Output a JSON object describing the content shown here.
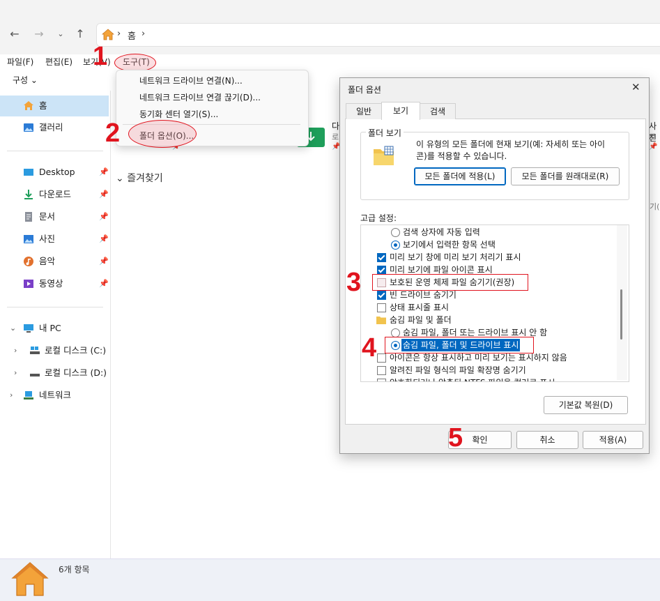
{
  "address": {
    "crumb": "홈"
  },
  "menubar": [
    {
      "label": "파일(F)"
    },
    {
      "label": "편집(E)"
    },
    {
      "label": "보기(V)"
    },
    {
      "label": "도구(T)"
    }
  ],
  "organize": "구성",
  "sidebar": {
    "home": "홈",
    "gallery": "갤러리",
    "pinned": [
      "Desktop",
      "다운로드",
      "문서",
      "사진",
      "음악",
      "동영상"
    ],
    "this_pc": "내 PC",
    "drive_c": "로컬 디스크 (C:)",
    "drive_d": "로컬 디스크 (D:)",
    "network": "네트워크"
  },
  "content": {
    "favorites": "즐겨찾기",
    "right_cut_1": "다",
    "right_cut_2": "로",
    "right_edge_1": "사진",
    "right_edge_2": "로",
    "right_edge_3": "기(",
    "pin_glyph": "📌"
  },
  "dropdown": [
    {
      "label": "네트워크 드라이브 연결(N)..."
    },
    {
      "label": "네트워크 드라이브 연결 끊기(D)..."
    },
    {
      "label": "동기화 센터 열기(S)..."
    },
    {
      "label": "폴더 옵션(O)..."
    }
  ],
  "dialog": {
    "title": "폴더 옵션",
    "close": "✕",
    "tabs": [
      "일반",
      "보기",
      "검색"
    ],
    "group_title": "폴더 보기",
    "group_desc_1": "이 유형의 모든 폴더에 현재 보기(예: 자세히 또는 아이",
    "group_desc_2": "콘)를 적용할 수 있습니다.",
    "apply_all": "모든 폴더에 적용(L)",
    "reset_all": "모든 폴더를 원래대로(R)",
    "advanced_label": "고급 설정:",
    "settings": [
      {
        "type": "radio",
        "checked": false,
        "indent": 2,
        "label": "검색 상자에 자동 입력"
      },
      {
        "type": "radio",
        "checked": true,
        "indent": 2,
        "label": "보기에서 입력한 항목 선택"
      },
      {
        "type": "check",
        "checked": true,
        "indent": 1,
        "label": "미리 보기 창에 미리 보기 처리기 표시"
      },
      {
        "type": "check",
        "checked": true,
        "indent": 1,
        "label": "미리 보기에 파일 아이콘 표시"
      },
      {
        "type": "check",
        "checked": false,
        "indent": 1,
        "label": "보호된 운영 체제 파일 숨기기(권장)"
      },
      {
        "type": "check",
        "checked": true,
        "indent": 1,
        "label": "빈 드라이브 숨기기"
      },
      {
        "type": "check",
        "checked": false,
        "indent": 1,
        "label": "상태 표시줄 표시"
      },
      {
        "type": "folder",
        "checked": false,
        "indent": 1,
        "label": "숨김 파일 및 폴더"
      },
      {
        "type": "radio",
        "checked": false,
        "indent": 2,
        "label": "숨김 파일, 폴더 또는 드라이브 표시 안 함"
      },
      {
        "type": "radio",
        "checked": true,
        "indent": 2,
        "label": "숨김 파일, 폴더 및 드라이브 표시"
      },
      {
        "type": "check",
        "checked": false,
        "indent": 1,
        "label": "아이콘은 항상 표시하고 미리 보기는 표시하지 않음"
      },
      {
        "type": "check",
        "checked": false,
        "indent": 1,
        "label": "알려진 파일 형식의 파일 확장명 숨기기"
      },
      {
        "type": "check",
        "checked": false,
        "indent": 1,
        "label": "암호화되거나 압축된 NTFS 파일을 컬러로 표시"
      }
    ],
    "restore_defaults": "기본값 복원(D)",
    "ok": "확인",
    "cancel": "취소",
    "apply": "적용(A)"
  },
  "annotations": [
    "1",
    "2",
    "3",
    "4",
    "5"
  ],
  "status": {
    "count": "6개 항목"
  },
  "colors": {
    "accent": "#0067c0",
    "annotation": "#e0141e",
    "selection": "#cce4f7"
  }
}
